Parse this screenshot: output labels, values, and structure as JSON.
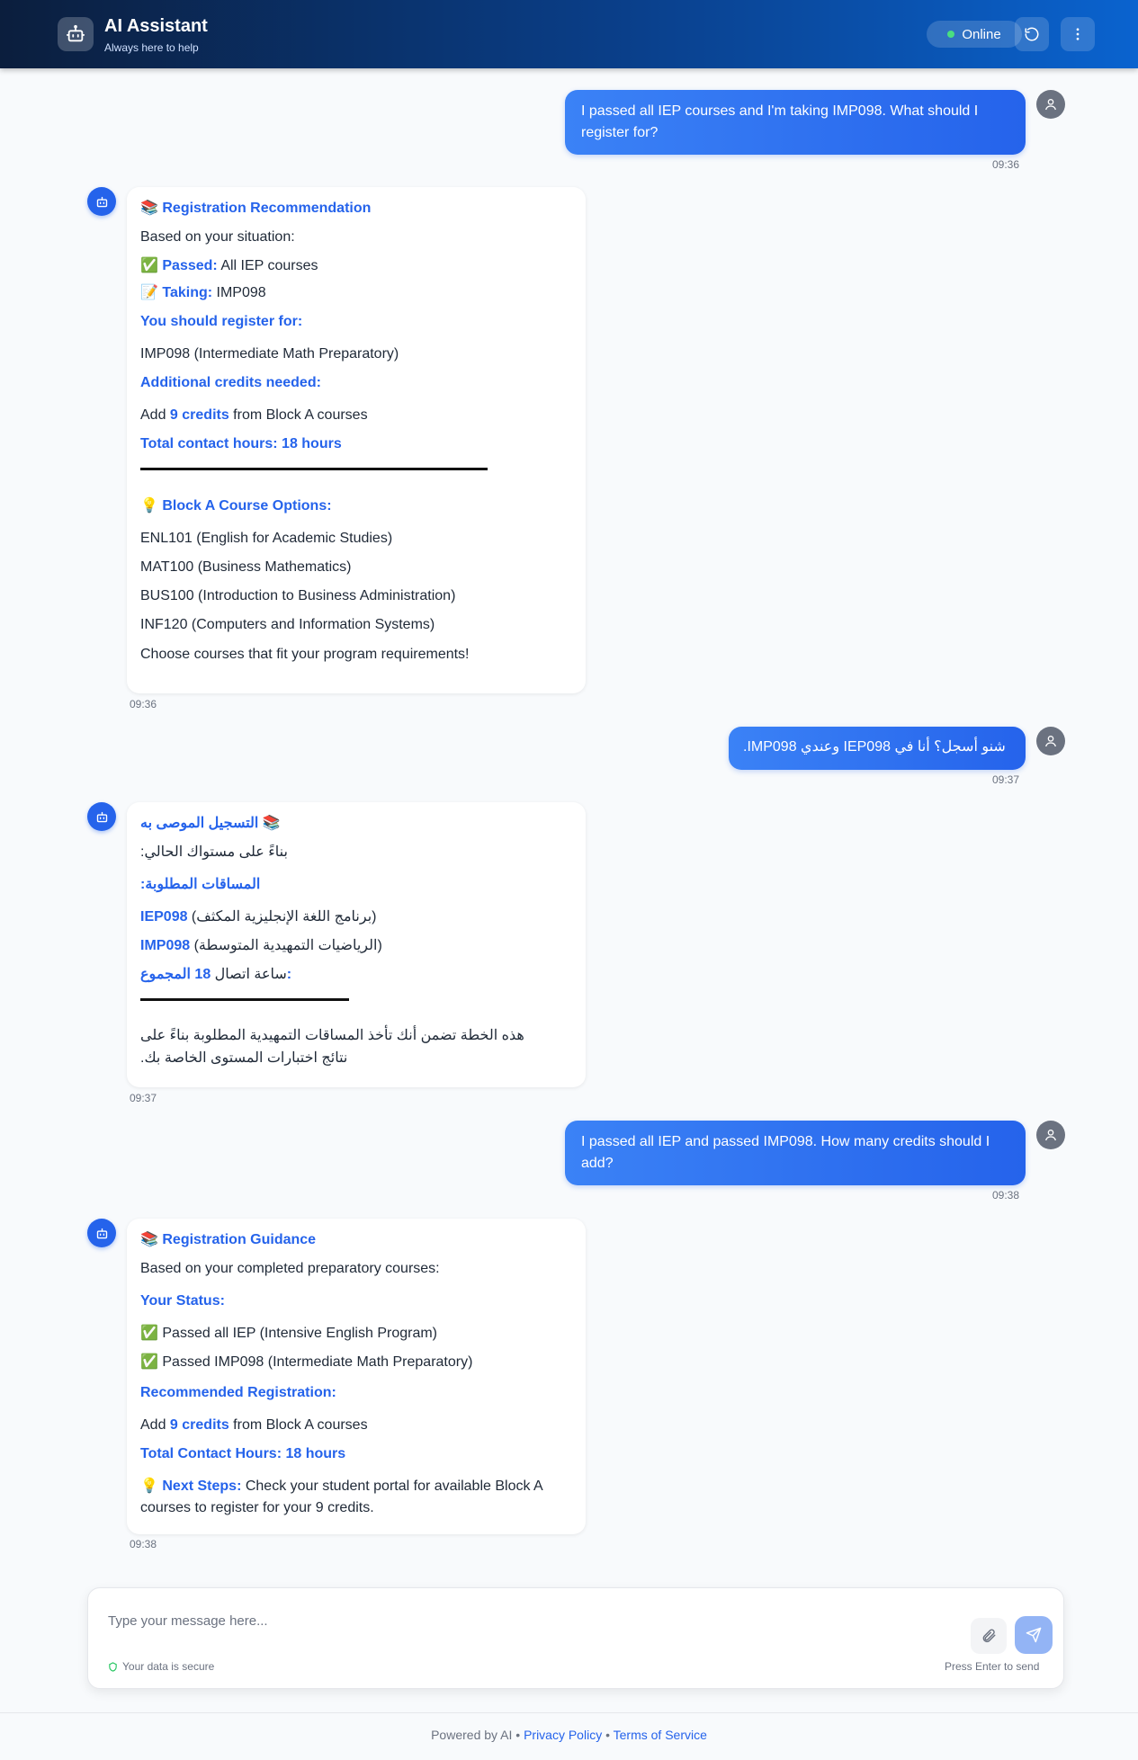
{
  "header": {
    "title": "AI Assistant",
    "subtitle": "Always here to help",
    "status": "Online",
    "colors": {
      "gradient_start": "#0b1e3d",
      "gradient_end": "#0a63cf",
      "status_dot": "#4ade80"
    }
  },
  "messages": {
    "m1": {
      "text": "I passed all IEP courses and I'm taking IMP098. What should I register for?",
      "time": "09:36"
    },
    "m2": {
      "title": "📚 Registration Recommendation",
      "intro": "Based on your situation:",
      "passed_label": "Passed:",
      "passed_value": " All IEP courses",
      "taking_label": "Taking:",
      "taking_value": " IMP098",
      "register_heading": "You should register for:",
      "register_item": "IMP098 (Intermediate Math Preparatory)",
      "credits_heading": "Additional credits needed:",
      "credits_pre": "Add ",
      "credits_kw": "9 credits",
      "credits_post": " from Block A courses",
      "hours_line": "Total contact hours: 18 hours",
      "options_heading": "Block A Course Options:",
      "options": [
        "ENL101 (English for Academic Studies)",
        "MAT100 (Business Mathematics)",
        "BUS100 (Introduction to Business Administration)",
        "INF120 (Computers and Information Systems)"
      ],
      "closing": "Choose courses that fit your program requirements!",
      "time": "09:36"
    },
    "m3": {
      "text": "شنو أسجل؟ أنا في IEP098 وعندي IMP098.",
      "time": "09:37"
    },
    "m4": {
      "title": "📚 التسجيل الموصى به",
      "intro": "بناءً على مستواك الحالي:",
      "required_heading": "المساقات المطلوبة:",
      "item1_code": "IEP098",
      "item1_desc": " (برنامج اللغة الإنجليزية المكثف)",
      "item2_code": "IMP098",
      "item2_desc": " (الرياضيات التمهيدية المتوسطة)",
      "total_label": "المجموع: ",
      "total_value": "18",
      "total_suffix": " ساعة اتصال",
      "note": "هذه الخطة تضمن أنك تأخذ المساقات التمهيدية المطلوبة بناءً على نتائج اختبارات المستوى الخاصة بك.",
      "time": "09:37"
    },
    "m5": {
      "text": "I passed all IEP and passed IMP098. How many credits should I add?",
      "time": "09:38"
    },
    "m6": {
      "title": "📚 Registration Guidance",
      "intro": "Based on your completed preparatory courses:",
      "status_heading": "Your Status:",
      "status_items": [
        "✅ Passed all IEP (Intensive English Program)",
        "✅ Passed IMP098 (Intermediate Math Preparatory)"
      ],
      "reco_heading": "Recommended Registration:",
      "credits_pre": "Add ",
      "credits_kw": "9 credits",
      "credits_post": " from Block A courses",
      "hours_line": "Total Contact Hours: 18 hours",
      "next_label": "Next Steps:",
      "next_text": " Check your student portal for available Block A courses to register for your 9 credits.",
      "time": "09:38"
    }
  },
  "composer": {
    "placeholder": "Type your message here...",
    "secure_text": "Your data is secure",
    "hint": "Press Enter to send"
  },
  "footer": {
    "powered": "Powered by AI • ",
    "privacy": "Privacy Policy",
    "sep": " • ",
    "terms": "Terms of Service"
  },
  "icons": {
    "logo": "robot-icon",
    "refresh": "refresh-icon",
    "menu": "more-vertical-icon",
    "user_avatar": "user-icon",
    "bot_avatar": "robot-icon",
    "attach": "paperclip-icon",
    "send": "send-icon",
    "secure": "shield-icon"
  }
}
